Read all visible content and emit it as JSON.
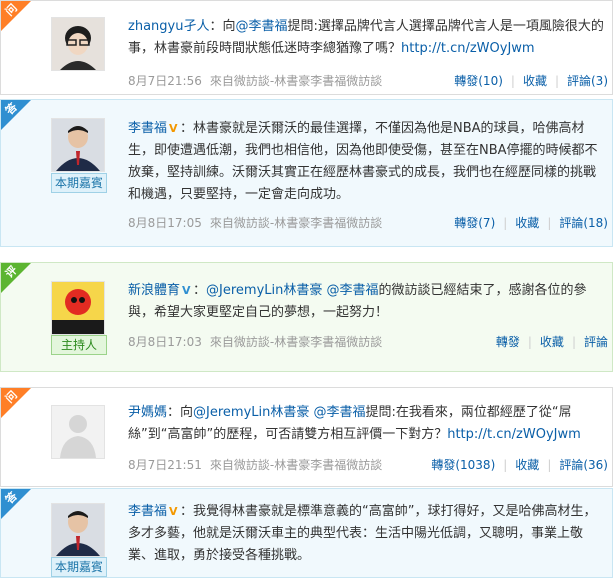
{
  "colors": {
    "question_tag": "#ff7f27",
    "answer_tag": "#2f8fd1",
    "comment_tag": "#5cb531",
    "link": "#0a5fa8",
    "meta_gray": "#9a9a9a"
  },
  "posts": [
    {
      "type": "question",
      "tag": "问",
      "user": "zhangyu孑人",
      "text_parts": [
        {
          "kind": "text",
          "value": "：向"
        },
        {
          "kind": "mention",
          "value": "@李書福"
        },
        {
          "kind": "text",
          "value": "提問:選擇品牌代言人選擇品牌代言人是一項風險很大的事，林書豪前段時間狀態低迷時李總猶豫了嗎？"
        },
        {
          "kind": "link",
          "value": "http://t.cn/zWOyJwm"
        }
      ],
      "time": "8月7日21:56",
      "source": "來自微訪談-林書豪李書福微訪談",
      "forward": "轉發(10)",
      "favorite": "收藏",
      "comment": "評論(3)"
    },
    {
      "type": "answer",
      "tag": "答",
      "user": "李書福",
      "badge": "本期嘉賓",
      "text_parts": [
        {
          "kind": "text",
          "value": "：林書豪就是沃爾沃的最佳選擇，不僅因為他是NBA的球員，哈佛高材生，即使遭遇低潮，我們也相信他，因為他即使受傷，甚至在NBA停擺的時候都不放棄，堅持訓練。沃爾沃其實正在經歷林書豪式的成長，我們也在經歷同樣的挑戰和機遇，只要堅持，一定會走向成功。"
        }
      ],
      "time": "8月8日17:05",
      "source": "來自微訪談-林書豪李書福微訪談",
      "forward": "轉發(7)",
      "favorite": "收藏",
      "comment": "評論(18)"
    },
    {
      "type": "comment",
      "tag": "评",
      "user": "新浪體育",
      "badge": "主持人",
      "text_parts": [
        {
          "kind": "text",
          "value": "："
        },
        {
          "kind": "mention",
          "value": "@JeremyLin林書豪"
        },
        {
          "kind": "text",
          "value": " "
        },
        {
          "kind": "mention",
          "value": "@李書福"
        },
        {
          "kind": "text",
          "value": "的微訪談已經結束了，感謝各位的參與，希望大家更堅定自己的夢想，一起努力！"
        }
      ],
      "time": "8月8日17:03",
      "source": "來自微訪談-林書豪李書福微訪談",
      "forward": "轉發",
      "favorite": "收藏",
      "comment": "評論"
    },
    {
      "type": "question",
      "tag": "问",
      "user": "尹媽媽",
      "text_parts": [
        {
          "kind": "text",
          "value": "：向"
        },
        {
          "kind": "mention",
          "value": "@JeremyLin林書豪"
        },
        {
          "kind": "text",
          "value": " "
        },
        {
          "kind": "mention",
          "value": "@李書福"
        },
        {
          "kind": "text",
          "value": "提問:在我看來，兩位都經歷了從“屌絲”到“高富帥”的歷程，可否請雙方相互評價一下對方？"
        },
        {
          "kind": "link",
          "value": "http://t.cn/zWOyJwm"
        }
      ],
      "time": "8月7日21:51",
      "source": "來自微訪談-林書豪李書福微訪談",
      "forward": "轉發(1038)",
      "favorite": "收藏",
      "comment": "評論(36)"
    },
    {
      "type": "answer",
      "tag": "答",
      "user": "李書福",
      "badge": "本期嘉賓",
      "text_parts": [
        {
          "kind": "text",
          "value": "：我覺得林書豪就是標準意義的“高富帥”，球打得好，又是哈佛高材生，多才多藝，他就是沃爾沃車主的典型代表：生活中陽光低調，又聰明，事業上敬業、進取，勇於接受各種挑戰。"
        }
      ]
    }
  ]
}
